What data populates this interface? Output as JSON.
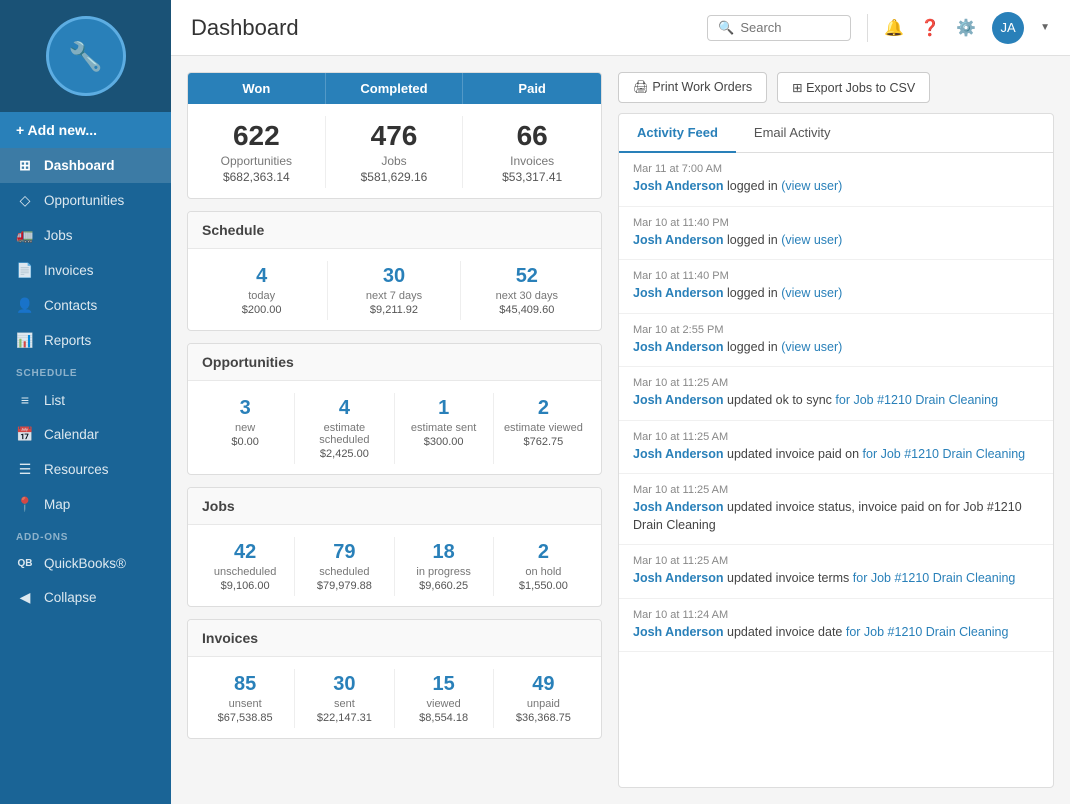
{
  "sidebar": {
    "logo_text": "🔧",
    "add_new_label": "+ Add new...",
    "nav_items": [
      {
        "id": "dashboard",
        "label": "Dashboard",
        "icon": "⊞",
        "active": true
      },
      {
        "id": "opportunities",
        "label": "Opportunities",
        "icon": "◇"
      },
      {
        "id": "jobs",
        "label": "Jobs",
        "icon": "🚛"
      },
      {
        "id": "invoices",
        "label": "Invoices",
        "icon": "📄"
      },
      {
        "id": "contacts",
        "label": "Contacts",
        "icon": "👤"
      },
      {
        "id": "reports",
        "label": "Reports",
        "icon": "📊"
      }
    ],
    "schedule_section": "SCHEDULE",
    "schedule_items": [
      {
        "id": "list",
        "label": "List",
        "icon": "≡"
      },
      {
        "id": "calendar",
        "label": "Calendar",
        "icon": "📅"
      },
      {
        "id": "resources",
        "label": "Resources",
        "icon": "☰"
      },
      {
        "id": "map",
        "label": "Map",
        "icon": "📍"
      }
    ],
    "addons_section": "ADD-ONS",
    "addon_items": [
      {
        "id": "quickbooks",
        "label": "QuickBooks®",
        "icon": "QB"
      },
      {
        "id": "collapse",
        "label": "Collapse",
        "icon": "◀"
      }
    ]
  },
  "header": {
    "title": "Dashboard",
    "search_placeholder": "Search"
  },
  "stats_bar": {
    "headers": [
      "Won",
      "Completed",
      "Paid"
    ],
    "cols": [
      {
        "big": "622",
        "label": "Opportunities",
        "amount": "$682,363.14"
      },
      {
        "big": "476",
        "label": "Jobs",
        "amount": "$581,629.16"
      },
      {
        "big": "66",
        "label": "Invoices",
        "amount": "$53,317.41"
      }
    ]
  },
  "schedule": {
    "title": "Schedule",
    "cols": [
      {
        "num": "4",
        "sub": "today",
        "amt": "$200.00"
      },
      {
        "num": "30",
        "sub": "next 7 days",
        "amt": "$9,211.92"
      },
      {
        "num": "52",
        "sub": "next 30 days",
        "amt": "$45,409.60"
      }
    ]
  },
  "opportunities": {
    "title": "Opportunities",
    "cols": [
      {
        "num": "3",
        "sub": "new",
        "amt": "$0.00"
      },
      {
        "num": "4",
        "sub": "estimate scheduled",
        "amt": "$2,425.00"
      },
      {
        "num": "1",
        "sub": "estimate sent",
        "amt": "$300.00"
      },
      {
        "num": "2",
        "sub": "estimate viewed",
        "amt": "$762.75"
      }
    ]
  },
  "jobs": {
    "title": "Jobs",
    "cols": [
      {
        "num": "42",
        "sub": "unscheduled",
        "amt": "$9,106.00"
      },
      {
        "num": "79",
        "sub": "scheduled",
        "amt": "$79,979.88"
      },
      {
        "num": "18",
        "sub": "in progress",
        "amt": "$9,660.25"
      },
      {
        "num": "2",
        "sub": "on hold",
        "amt": "$1,550.00"
      }
    ]
  },
  "invoices": {
    "title": "Invoices",
    "cols": [
      {
        "num": "85",
        "sub": "unsent",
        "amt": "$67,538.85"
      },
      {
        "num": "30",
        "sub": "sent",
        "amt": "$22,147.31"
      },
      {
        "num": "15",
        "sub": "viewed",
        "amt": "$8,554.18"
      },
      {
        "num": "49",
        "sub": "unpaid",
        "amt": "$36,368.75"
      }
    ]
  },
  "actions": {
    "print_label": "🖨 Print Work Orders",
    "export_label": "⊞ Export Jobs to CSV"
  },
  "feed": {
    "tabs": [
      "Activity Feed",
      "Email Activity"
    ],
    "active_tab": 0,
    "items": [
      {
        "time": "Mar 11 at 7:00 AM",
        "user": "Josh Anderson",
        "text": " logged in ",
        "link": "(view user)",
        "rest": ""
      },
      {
        "time": "Mar 10 at 11:40 PM",
        "user": "Josh Anderson",
        "text": " logged in ",
        "link": "(view user)",
        "rest": ""
      },
      {
        "time": "Mar 10 at 11:40 PM",
        "user": "Josh Anderson",
        "text": " logged in ",
        "link": "(view user)",
        "rest": ""
      },
      {
        "time": "Mar 10 at 2:55 PM",
        "user": "Josh Anderson",
        "text": " logged in ",
        "link": "(view user)",
        "rest": ""
      },
      {
        "time": "Mar 10 at 11:25 AM",
        "user": "Josh Anderson",
        "text": " updated ok to sync ",
        "link": "for Job #1210 Drain Cleaning",
        "rest": ""
      },
      {
        "time": "Mar 10 at 11:25 AM",
        "user": "Josh Anderson",
        "text": " updated invoice paid on ",
        "link": "for Job #1210 Drain Cleaning",
        "rest": ""
      },
      {
        "time": "Mar 10 at 11:25 AM",
        "user": "Josh Anderson",
        "text": " updated invoice status, invoice paid on for Job #1210 Drain Cleaning",
        "link": "",
        "rest": ""
      },
      {
        "time": "Mar 10 at 11:25 AM",
        "user": "Josh Anderson",
        "text": " updated invoice terms ",
        "link": "for Job #1210 Drain Cleaning",
        "rest": ""
      },
      {
        "time": "Mar 10 at 11:24 AM",
        "user": "Josh Anderson",
        "text": " updated invoice date ",
        "link": "for Job #1210 Drain Cleaning",
        "rest": ""
      }
    ]
  }
}
